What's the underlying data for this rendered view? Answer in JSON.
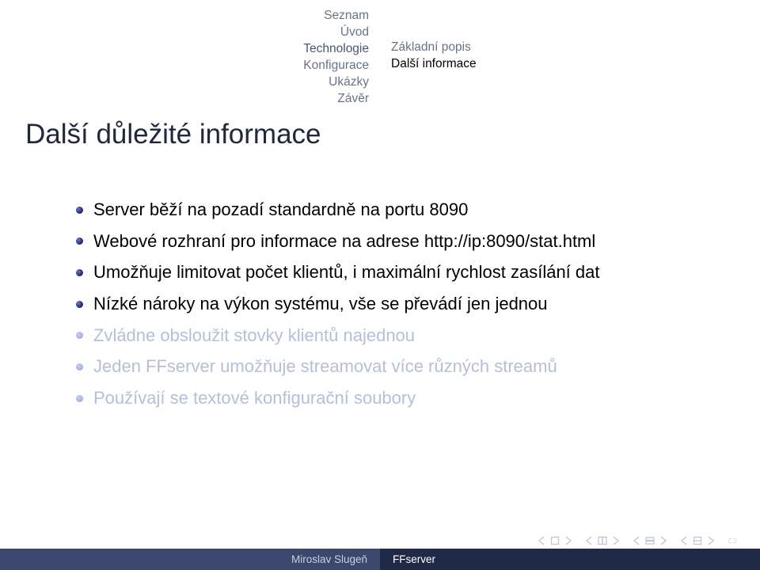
{
  "nav": {
    "left": [
      "Seznam",
      "Úvod",
      "Technologie",
      "Konfigurace",
      "Ukázky",
      "Závěr"
    ],
    "left_active_index": 2,
    "right": [
      "Základní popis",
      "Další informace"
    ],
    "right_current_index": 1
  },
  "frametitle": "Další důležité informace",
  "items": [
    {
      "text": "Server běží na pozadí standardně na portu 8090",
      "dim": false
    },
    {
      "text": "Webové rozhraní pro informace na adrese http://ip:8090/stat.html",
      "dim": false
    },
    {
      "text": "Umožňuje limitovat počet klientů, i maximální rychlost zasílání dat",
      "dim": false
    },
    {
      "text": "Nízké nároky na výkon systému, vše se převádí jen jednou",
      "dim": false
    },
    {
      "text": "Zvládne obsloužit stovky klientů najednou",
      "dim": true
    },
    {
      "text": "Jeden FFserver umožňuje streamovat více různých streamů",
      "dim": true
    },
    {
      "text": "Používají se textové konfigurační soubory",
      "dim": true
    }
  ],
  "footer": {
    "author": "Miroslav Slugeň",
    "title": "FFserver"
  }
}
